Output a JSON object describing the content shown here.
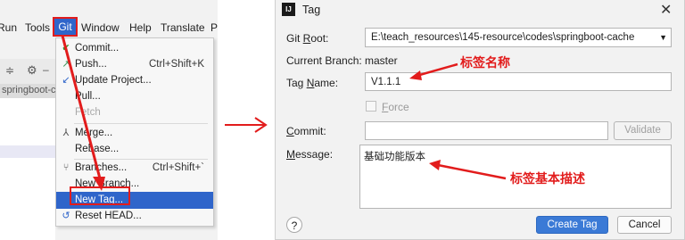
{
  "menubar": {
    "run": "Run",
    "tools": "Tools",
    "git": "Git",
    "window": "Window",
    "help": "Help",
    "translate": "Translate",
    "p": "P"
  },
  "ide": {
    "tree_item": "springboot-c"
  },
  "git_menu": {
    "commit": "Commit...",
    "push": "Push...",
    "push_shortcut": "Ctrl+Shift+K",
    "update_project": "Update Project...",
    "pull": "Pull...",
    "fetch": "Fetch",
    "merge": "Merge...",
    "rebase": "Rebase...",
    "branches": "Branches...",
    "branches_shortcut": "Ctrl+Shift+`",
    "new_branch": "New Branch...",
    "new_tag": "New Tag...",
    "reset_head": "Reset HEAD..."
  },
  "dialog": {
    "title": "Tag",
    "app_icon_text": "IJ",
    "git_root_label": "Git Root:",
    "git_root_value": "E:\\teach_resources\\145-resource\\codes\\springboot-cache",
    "current_branch_label": "Current Branch:",
    "current_branch_value": "master",
    "tag_name_label": "Tag Name:",
    "tag_name_value": "V1.1.1",
    "force_label": "Force",
    "commit_label": "Commit:",
    "commit_value": "",
    "validate_label": "Validate",
    "message_label": "Message:",
    "message_value": "基础功能版本",
    "help_label": "?",
    "create_tag_label": "Create Tag",
    "cancel_label": "Cancel"
  },
  "annotations": {
    "tag_name_note": "标签名称",
    "message_note": "标签基本描述"
  },
  "colors": {
    "annotation_red": "#e21c1c",
    "selection_blue": "#2f65ca",
    "primary_button": "#3b7ad6"
  }
}
